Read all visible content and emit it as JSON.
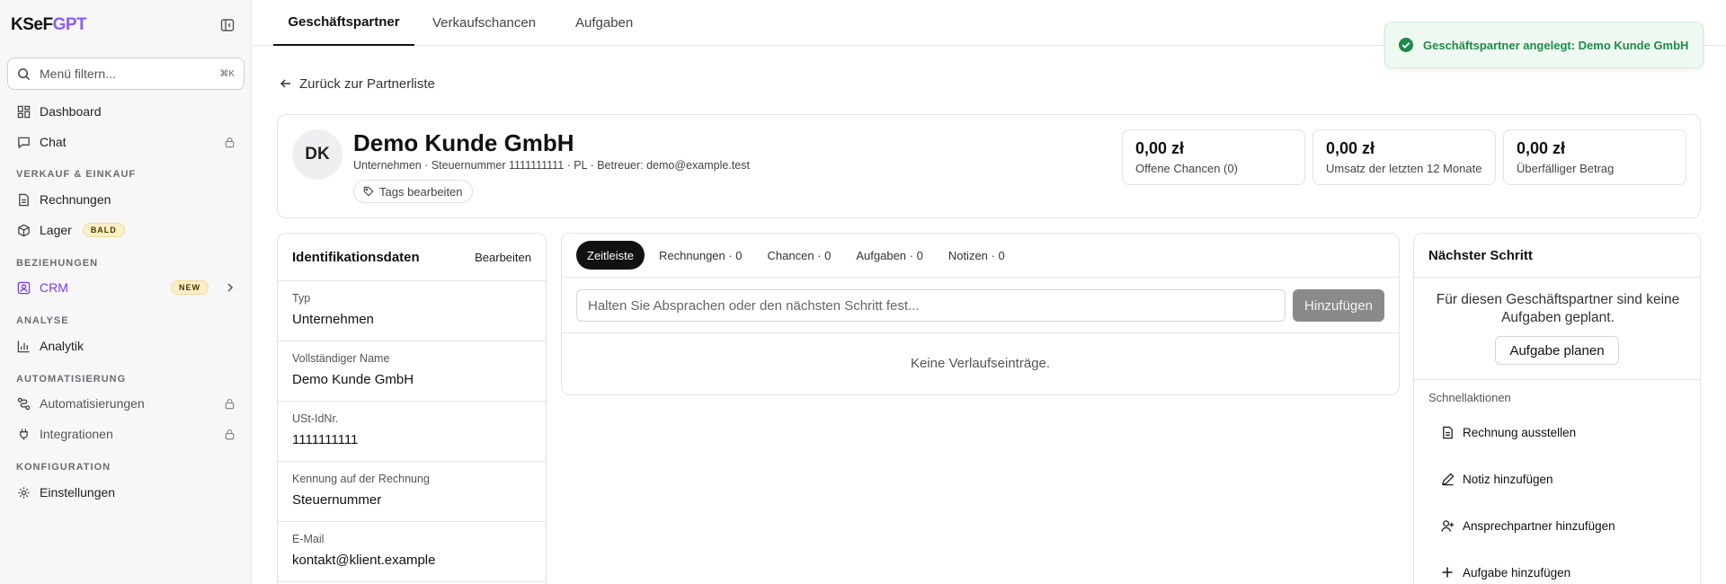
{
  "brand": {
    "logo_main": "KSeF",
    "logo_accent": "GPT"
  },
  "sidebar": {
    "search_placeholder": "Menü filtern...",
    "search_shortcut": "⌘K",
    "items": [
      {
        "label": "Dashboard"
      },
      {
        "label": "Chat"
      },
      {
        "label": "Rechnungen"
      },
      {
        "label": "Lager",
        "badge": "BALD"
      },
      {
        "label": "CRM",
        "badge": "NEW"
      },
      {
        "label": "Analytik"
      },
      {
        "label": "Automatisierungen"
      },
      {
        "label": "Integrationen"
      },
      {
        "label": "Einstellungen"
      }
    ],
    "sections": [
      "VERKAUF & EINKAUF",
      "BEZIEHUNGEN",
      "ANALYSE",
      "AUTOMATISIERUNG",
      "KONFIGURATION"
    ]
  },
  "topnav": {
    "tabs": [
      "Geschäftspartner",
      "Verkaufschancen",
      "Aufgaben"
    ]
  },
  "toast": {
    "text": "Geschäftspartner angelegt: Demo Kunde GmbH",
    "color": "#1e8a4a"
  },
  "back_link": "Zurück zur Partnerliste",
  "partner": {
    "initials": "DK",
    "name": "Demo Kunde GmbH",
    "meta": "Unternehmen · Steuernummer 1111111111 · PL · Betreuer: demo@example.test",
    "tags_label": "Tags bearbeiten"
  },
  "stats": [
    {
      "value": "0,00 zł",
      "label": "Offene Chancen (0)"
    },
    {
      "value": "0,00 zł",
      "label": "Umsatz der letzten 12 Monate"
    },
    {
      "value": "0,00 zł",
      "label": "Überfälliger Betrag"
    }
  ],
  "identification": {
    "title": "Identifikationsdaten",
    "edit_label": "Bearbeiten",
    "fields": [
      {
        "label": "Typ",
        "value": "Unternehmen"
      },
      {
        "label": "Vollständiger Name",
        "value": "Demo Kunde GmbH"
      },
      {
        "label": "USt-IdNr.",
        "value": "1111111111"
      },
      {
        "label": "Kennung auf der Rechnung",
        "value": "Steuernummer"
      },
      {
        "label": "E-Mail",
        "value": "kontakt@klient.example"
      }
    ]
  },
  "timeline": {
    "tabs": [
      "Zeitleiste",
      "Rechnungen · 0",
      "Chancen · 0",
      "Aufgaben · 0",
      "Notizen · 0"
    ],
    "input_placeholder": "Halten Sie Absprachen oder den nächsten Schritt fest...",
    "add_label": "Hinzufügen",
    "empty": "Keine Verlaufseinträge."
  },
  "next_step": {
    "title": "Nächster Schritt",
    "message": "Für diesen Geschäftspartner sind keine Aufgaben geplant.",
    "plan_label": "Aufgabe planen",
    "quick_label": "Schnellaktionen",
    "actions": [
      {
        "label": "Rechnung ausstellen"
      },
      {
        "label": "Notiz hinzufügen"
      },
      {
        "label": "Ansprechpartner hinzufügen"
      },
      {
        "label": "Aufgabe hinzufügen"
      }
    ]
  }
}
